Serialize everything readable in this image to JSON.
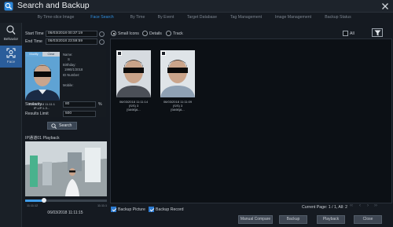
{
  "window": {
    "title": "Search and Backup"
  },
  "tabs": [
    {
      "label": "By Time-slice Image"
    },
    {
      "label": "Face Search"
    },
    {
      "label": "By Time"
    },
    {
      "label": "By Event"
    },
    {
      "label": "Target Database"
    },
    {
      "label": "Tag Management"
    },
    {
      "label": "Image Management"
    },
    {
      "label": "Backup Status"
    }
  ],
  "sidebar": {
    "items": [
      {
        "label": "Behavior"
      },
      {
        "label": "Face"
      }
    ]
  },
  "left": {
    "start_label": "Start Time",
    "start_value": "06/03/2018 00:37:19",
    "end_label": "End Time",
    "end_value": "06/03/2018 23:59:59",
    "card": {
      "tab1": "Modify",
      "tab2": "Clear",
      "info_lines": [
        "Name:",
        "S",
        "Birthday:",
        "1990/1/2018",
        "ID Number:",
        "",
        "Mobile:"
      ],
      "meta_line1": "06/03/2018 11:11:1",
      "meta_line2": "IP-UP.1-3..."
    },
    "similarity_label": "Similarity",
    "similarity_value": "80",
    "similarity_unit": "%",
    "limit_label": "Results Limit",
    "limit_value": "500",
    "search_label": "Search",
    "playback_label": "IP通道01 Playback",
    "time_start": "11:11:12",
    "time_end": "11:11:1",
    "playback_time": "06/03/2018 11:11:15"
  },
  "main": {
    "view_options": [
      "Small Icons",
      "Details",
      "Track"
    ],
    "all_label": "All",
    "results": [
      {
        "line1": "06/03/2018 11:11:14",
        "line2": "(S/S) 3",
        "line3": "[9A98]A..."
      },
      {
        "line1": "06/03/2018 11:11:09",
        "line2": "(S/S) 3",
        "line3": "[9A98]A..."
      }
    ],
    "backup_picture": "Backup Picture",
    "backup_record": "Backup Record",
    "page_label": "Current Page: 1 / 1, All: 2",
    "buttons": {
      "manual_compare": "Manual Compare",
      "backup": "Backup",
      "playback": "Playback",
      "close": "Close"
    }
  },
  "colors": {
    "accent": "#2f8fe0",
    "sidebar_selected": "#2a5d9b",
    "background": "#151a21"
  }
}
